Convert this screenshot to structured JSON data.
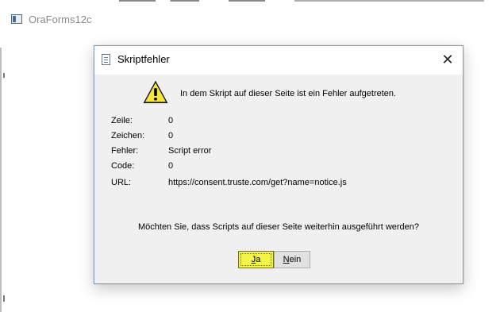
{
  "background_window": {
    "title": "OraForms12c",
    "icon": "window-app-icon"
  },
  "dialog": {
    "title": "Skriptfehler",
    "title_icon": "document-icon",
    "close_glyph": "✕",
    "warning_icon": "warning-icon",
    "message": "In dem Skript auf dieser Seite ist ein Fehler aufgetreten.",
    "details": [
      {
        "label": "Zeile:",
        "value": "0"
      },
      {
        "label": "Zeichen:",
        "value": "0"
      },
      {
        "label": "Fehler:",
        "value": "Script error"
      },
      {
        "label": "Code:",
        "value": "0"
      },
      {
        "label": "URL:",
        "value": "https://consent.truste.com/get?name=notice.js"
      }
    ],
    "question": "Möchten Sie, dass Scripts auf dieser Seite weiterhin ausgeführt werden?",
    "buttons": {
      "yes": {
        "mnemonic": "J",
        "rest": "a"
      },
      "no": {
        "mnemonic": "N",
        "rest": "ein"
      }
    }
  },
  "colors": {
    "yes_button_highlight": "#f4f44a",
    "dialog_background": "#f0f0f0",
    "warning_yellow": "#f7e43a"
  }
}
